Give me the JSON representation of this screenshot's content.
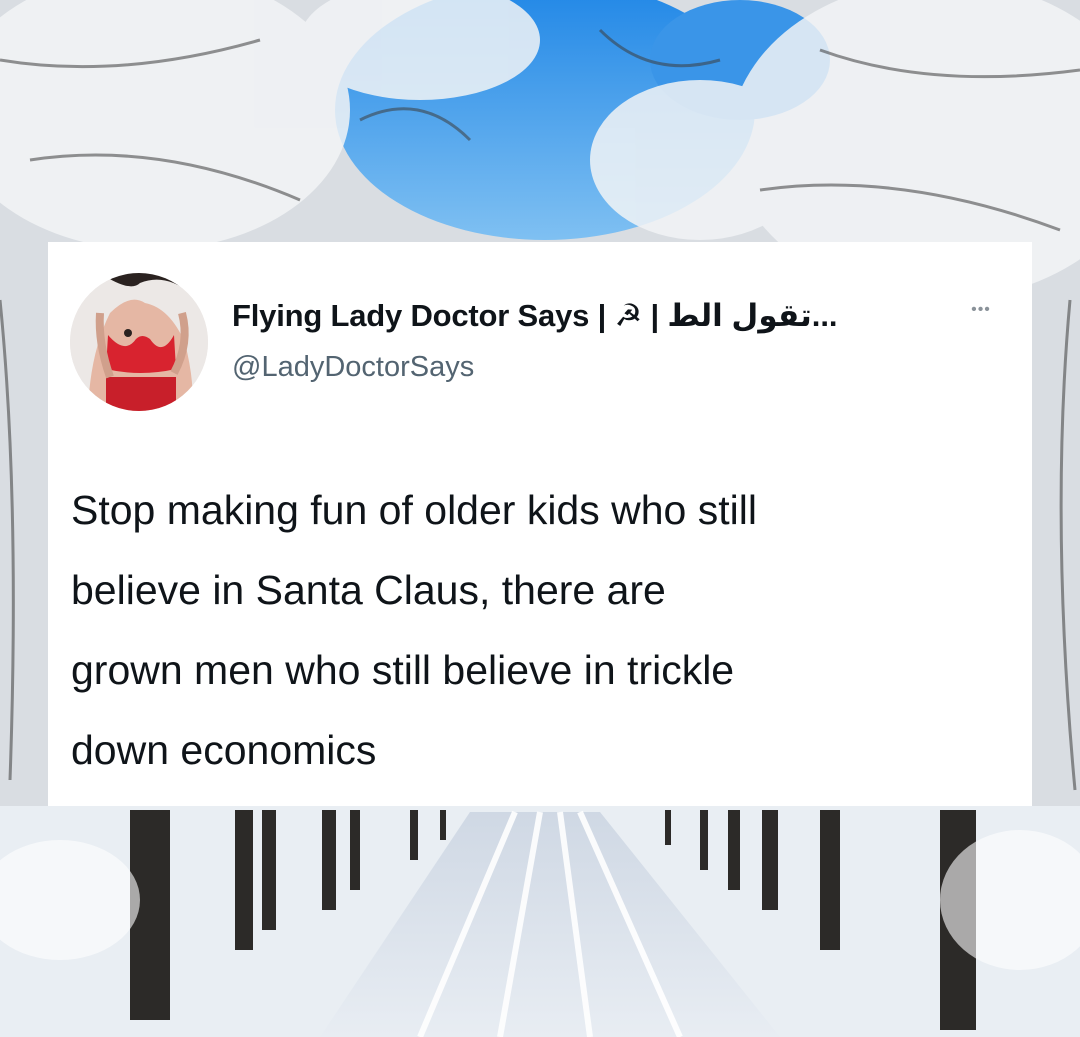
{
  "tweet": {
    "display_name": "Flying Lady Doctor Says | ☭ | تقول الط...",
    "handle": "@LadyDoctorSays",
    "more_icon": "more-horizontal-icon",
    "text_lines": [
      "Stop making fun of older kids who still",
      "believe in Santa Claus, there are",
      "grown men who still believe in trickle",
      "down economics"
    ]
  },
  "colors": {
    "card_background": "#ffffff",
    "text_primary": "#0f1419",
    "text_secondary": "#536471",
    "sky": "#2f8fe3"
  }
}
